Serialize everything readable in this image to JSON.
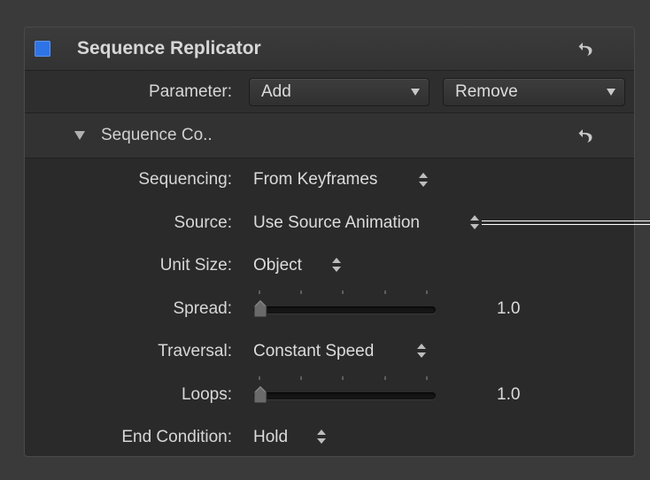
{
  "header": {
    "title": "Sequence Replicator",
    "enable_color": "#2f74e6"
  },
  "parameter_row": {
    "label": "Parameter:",
    "add_label": "Add",
    "remove_label": "Remove"
  },
  "group": {
    "title": "Sequence Co.."
  },
  "rows": {
    "sequencing": {
      "label": "Sequencing:",
      "value": "From Keyframes"
    },
    "source": {
      "label": "Source:",
      "value": "Use Source Animation"
    },
    "unit_size": {
      "label": "Unit Size:",
      "value": "Object"
    },
    "spread": {
      "label": "Spread:",
      "value": "1.0",
      "slider_fraction": 0.0
    },
    "traversal": {
      "label": "Traversal:",
      "value": "Constant Speed"
    },
    "loops": {
      "label": "Loops:",
      "value": "1.0",
      "slider_fraction": 0.0
    },
    "end_condition": {
      "label": "End Condition:",
      "value": "Hold"
    }
  },
  "icons": {
    "reset": "reset-arrow-icon",
    "stepper": "up-down-stepper-icon",
    "disclosure": "disclosure-triangle-icon",
    "popup_arrow": "chevron-down-icon"
  }
}
